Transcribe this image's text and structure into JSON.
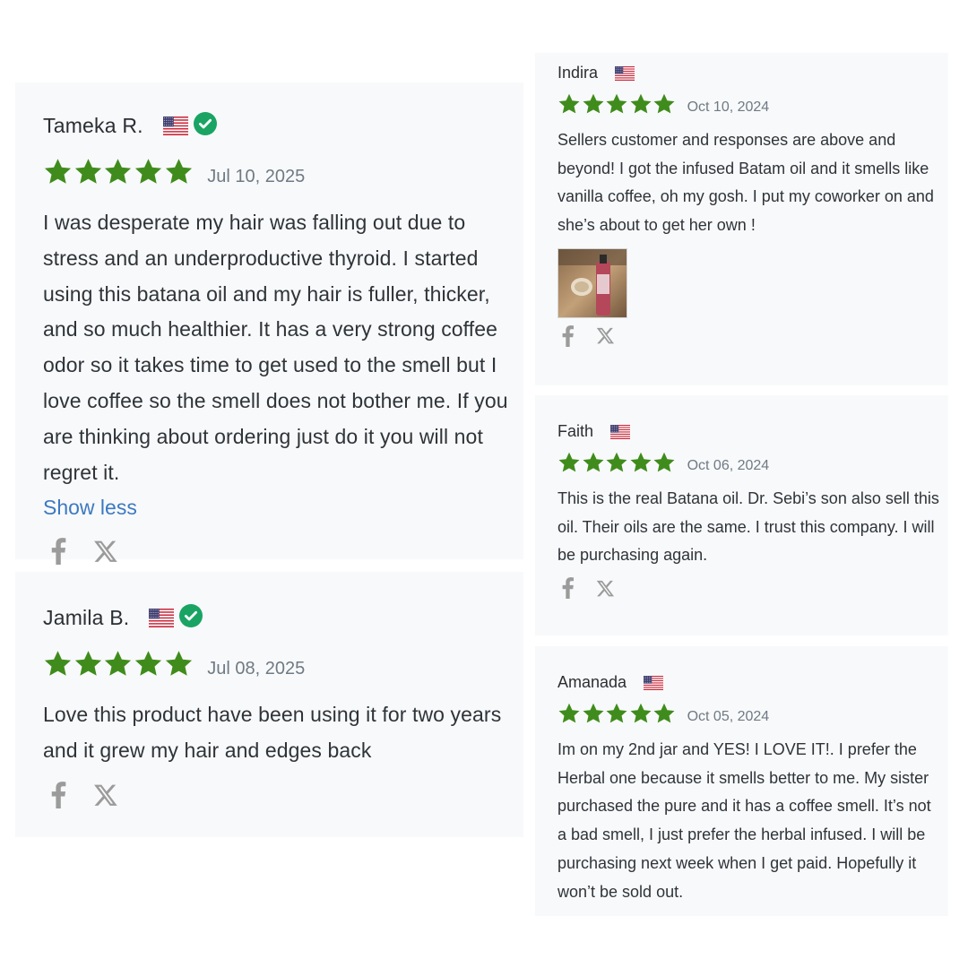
{
  "colors": {
    "star": "#3f8c1c",
    "verified": "#19a463",
    "card_bg": "#f8f9fa",
    "link": "#3c79c2",
    "social_icon": "#9b9b9b"
  },
  "reviews": [
    {
      "id": "tameka",
      "name": "Tameka R.",
      "flag": "us-flag-icon",
      "verified": true,
      "rating": 5,
      "date": "Jul 10, 2025",
      "text": "I was desperate my hair was falling out due to stress and an underproductive thyroid. I started using this batana oil and my hair is fuller, thicker, and so much healthier. It has a very strong coffee odor so it takes time to get used to the smell but I love coffee so the smell does not bother me. If you are thinking about ordering just do it you will not regret it.",
      "toggle_label": "Show less"
    },
    {
      "id": "jamila",
      "name": "Jamila B.",
      "flag": "us-flag-icon",
      "verified": true,
      "rating": 5,
      "date": "Jul 08, 2025",
      "text": "Love this product have been using it for two years and it grew my hair and edges back"
    },
    {
      "id": "indira",
      "name": "Indira",
      "flag": "us-flag-icon",
      "verified": false,
      "rating": 5,
      "date": "Oct 10, 2024",
      "text": "Sellers customer and responses are above and beyond! I got the infused Batam oil and it smells like vanilla coffee, oh my gosh.  I put my coworker on and she’s about to get her own !",
      "has_photo": true
    },
    {
      "id": "faith",
      "name": "Faith",
      "flag": "us-flag-icon",
      "verified": false,
      "rating": 5,
      "date": "Oct 06, 2024",
      "text": "This is the real Batana oil. Dr. Sebi’s son also sell this oil. Their oils are the same. I trust this company. I will be purchasing again."
    },
    {
      "id": "amanada",
      "name": "Amanada",
      "flag": "us-flag-icon",
      "verified": false,
      "rating": 5,
      "date": "Oct 05, 2024",
      "text": "Im on my 2nd jar and YES! I LOVE IT!. I prefer the Herbal one because it smells better to me. My sister purchased the pure and it has a coffee smell. It’s not a bad smell, I just prefer the herbal infused. I will be purchasing next week when I get paid. Hopefully it won’t be sold out."
    }
  ],
  "social_icons": [
    "facebook-icon",
    "x-twitter-icon"
  ]
}
